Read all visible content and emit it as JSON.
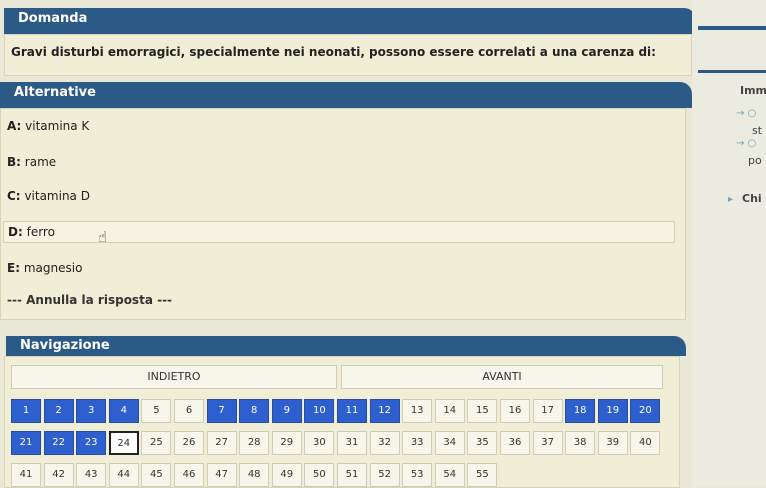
{
  "question": {
    "header": "Domanda",
    "text": "Gravi disturbi emorragici, specialmente nei neonati, possono essere correlati a una carenza di:"
  },
  "alternatives": {
    "header": "Alternative",
    "options": [
      {
        "key": "A:",
        "text": "vitamina K"
      },
      {
        "key": "B:",
        "text": "rame"
      },
      {
        "key": "C:",
        "text": "vitamina D"
      },
      {
        "key": "D:",
        "text": "ferro"
      },
      {
        "key": "E:",
        "text": "magnesio"
      }
    ],
    "clear": "--- Annulla la risposta ---"
  },
  "navigation": {
    "header": "Navigazione",
    "back": "INDIETRO",
    "next": "AVANTI",
    "rows": [
      [
        "1",
        "2",
        "3",
        "4",
        "5",
        "6",
        "7",
        "8",
        "9",
        "10",
        "11",
        "12",
        "13",
        "14",
        "15",
        "16",
        "17",
        "18",
        "19",
        "20"
      ],
      [
        "21",
        "22",
        "23",
        "24",
        "25",
        "26",
        "27",
        "28",
        "29",
        "30",
        "31",
        "32",
        "33",
        "34",
        "35",
        "36",
        "37",
        "38",
        "39",
        "40"
      ],
      [
        "41",
        "42",
        "43",
        "44",
        "45",
        "46",
        "47",
        "48",
        "49",
        "50",
        "51",
        "52",
        "53",
        "54",
        "55"
      ]
    ],
    "answered": [
      "1",
      "2",
      "3",
      "4",
      "7",
      "8",
      "9",
      "10",
      "11",
      "12",
      "18",
      "19",
      "20",
      "21",
      "22",
      "23"
    ],
    "current": "24"
  },
  "side": {
    "label1": "Imm",
    "label2": "st",
    "label3": "po",
    "label4": "Chi"
  }
}
